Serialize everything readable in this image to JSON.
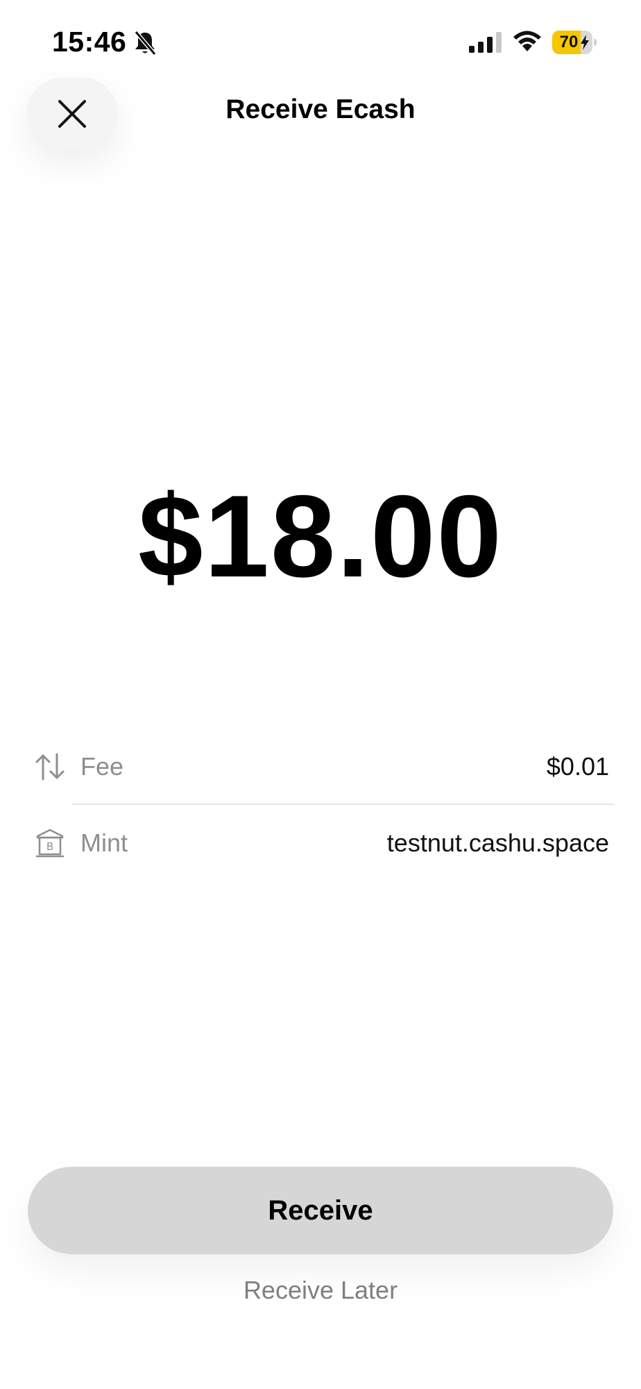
{
  "status_bar": {
    "time": "15:46",
    "battery_level": "70",
    "battery_fraction": 0.7,
    "battery_color": "#f6c700",
    "icons": [
      "bell-slash-icon",
      "cellular-signal-icon",
      "wifi-icon",
      "battery-icon",
      "charging-bolt-icon"
    ]
  },
  "header": {
    "title": "Receive Ecash",
    "close_icon": "close-icon"
  },
  "amount": {
    "display": "$18.00"
  },
  "details": {
    "fee": {
      "label": "Fee",
      "value": "$0.01",
      "icon": "arrows-up-down-icon"
    },
    "mint": {
      "label": "Mint",
      "value": "testnut.cashu.space",
      "icon": "bank-bitcoin-icon"
    }
  },
  "actions": {
    "receive_label": "Receive",
    "receive_later_label": "Receive Later"
  },
  "colors": {
    "button_background": "#d6d6d6",
    "secondary_text": "#8e8e8e",
    "divider": "#e6e6e6"
  }
}
